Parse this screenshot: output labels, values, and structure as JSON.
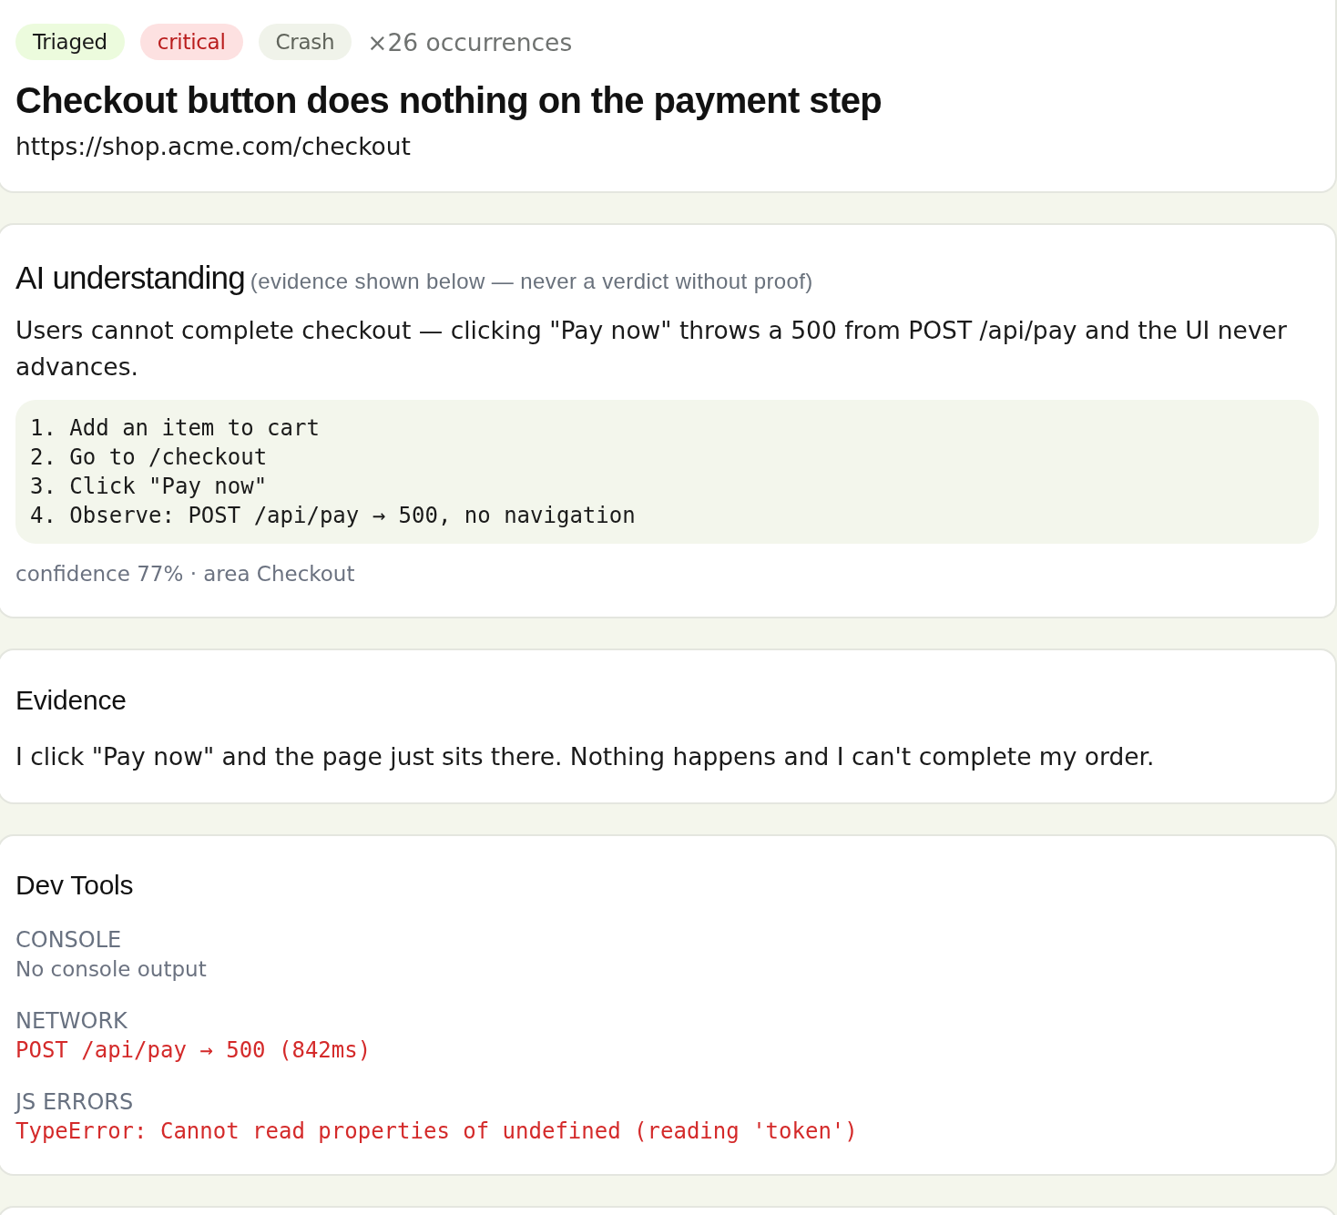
{
  "header": {
    "tags": [
      {
        "kind": "status",
        "label": "Triaged"
      },
      {
        "kind": "severity",
        "label": "critical"
      },
      {
        "kind": "category",
        "label": "Crash"
      }
    ],
    "occurrences": "×26 occurrences",
    "title": "Checkout button does nothing on the payment step",
    "url": "https://shop.acme.com/checkout"
  },
  "ai_understanding": {
    "heading": "AI understanding",
    "note": "(evidence shown below — never a verdict without proof)",
    "summary": "Users cannot complete checkout — clicking \"Pay now\" throws a 500 from POST /api/pay and the UI never advances.",
    "steps": [
      "1. Add an item to cart",
      "2. Go to /checkout",
      "3. Click \"Pay now\"",
      "4. Observe: POST /api/pay → 500, no navigation"
    ],
    "meta": "confidence 77% · area Checkout"
  },
  "evidence": {
    "heading": "Evidence",
    "quote": "I click \"Pay now\" and the page just sits there. Nothing happens and I can't complete my order."
  },
  "dev_tools": {
    "heading": "Dev Tools",
    "sections": [
      {
        "label": "CONSOLE",
        "kind": "empty",
        "text": "No console output"
      },
      {
        "label": "NETWORK",
        "kind": "error",
        "text": "POST /api/pay → 500 (842ms)"
      },
      {
        "label": "JS ERRORS",
        "kind": "error",
        "text": "TypeError: Cannot read properties of undefined (reading 'token')"
      }
    ]
  }
}
